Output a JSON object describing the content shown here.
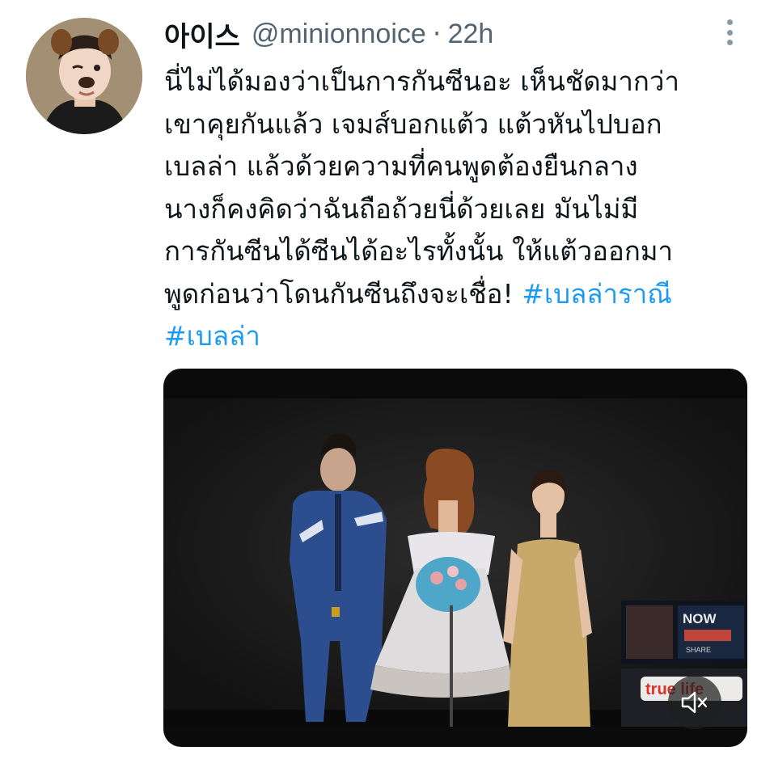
{
  "tweet": {
    "author_name": "아이스",
    "author_handle": "@minionnoice",
    "separator": "·",
    "timestamp": "22h",
    "lines": [
      "นี่ไม่ได้มองว่าเป็นการกันซีนอะ เห็นชัดมากว่า",
      "เขาคุยกันแล้ว เจมส์บอกแต้ว แต้วหันไปบอก",
      "เบลล่า แล้วด้วยความที่คนพูดต้องยืนกลาง",
      "นางก็คงคิดว่าฉันถือถ้วยนี่ด้วยเลย มันไม่มี",
      "การกันซีนได้ซีนได้อะไรทั้งนั้น ให้แต้วออกมา"
    ],
    "last_line_text": "พูดก่อนว่าโดนกันซีนถึงจะเชื่อ! ",
    "hashtags": [
      "#เบลล่าราณี",
      "#เบลล่า"
    ]
  },
  "media": {
    "sign_text": "NOW",
    "sign_subtext": "SHARE",
    "logo_text": "true life"
  },
  "icons": {
    "more": "more-vertical-icon",
    "sound": "speaker-muted-icon"
  },
  "colors": {
    "hashtag": "#1d9bf0",
    "secondary_text": "#536471"
  }
}
